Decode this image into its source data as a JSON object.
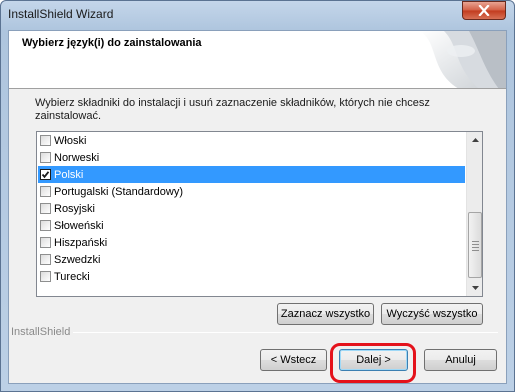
{
  "window": {
    "title": "InstallShield Wizard"
  },
  "header": {
    "title": "Wybierz język(i) do zainstalowania"
  },
  "description": "Wybierz składniki do instalacji i usuń zaznaczenie składników, których nie chcesz zainstalować.",
  "languages": [
    {
      "label": "Włoski",
      "checked": false,
      "selected": false
    },
    {
      "label": "Norweski",
      "checked": false,
      "selected": false
    },
    {
      "label": "Polski",
      "checked": true,
      "selected": true
    },
    {
      "label": "Portugalski (Standardowy)",
      "checked": false,
      "selected": false
    },
    {
      "label": "Rosyjski",
      "checked": false,
      "selected": false
    },
    {
      "label": "Słoweński",
      "checked": false,
      "selected": false
    },
    {
      "label": "Hiszpański",
      "checked": false,
      "selected": false
    },
    {
      "label": "Szwedzki",
      "checked": false,
      "selected": false
    },
    {
      "label": "Turecki",
      "checked": false,
      "selected": false
    }
  ],
  "buttons": {
    "select_all": "Zaznacz wszystko",
    "clear_all": "Wyczyść wszystko",
    "back": "< Wstecz",
    "next": "Dalej >",
    "cancel": "Anuluj"
  },
  "footer": {
    "brand": "InstallShield"
  },
  "colors": {
    "selection": "#3399ff",
    "highlight_ring": "#e4121b"
  },
  "icons": {
    "close": "close-icon",
    "scroll_up": "chevron-up-icon",
    "scroll_down": "chevron-down-icon",
    "checkmark": "checkmark-icon"
  }
}
